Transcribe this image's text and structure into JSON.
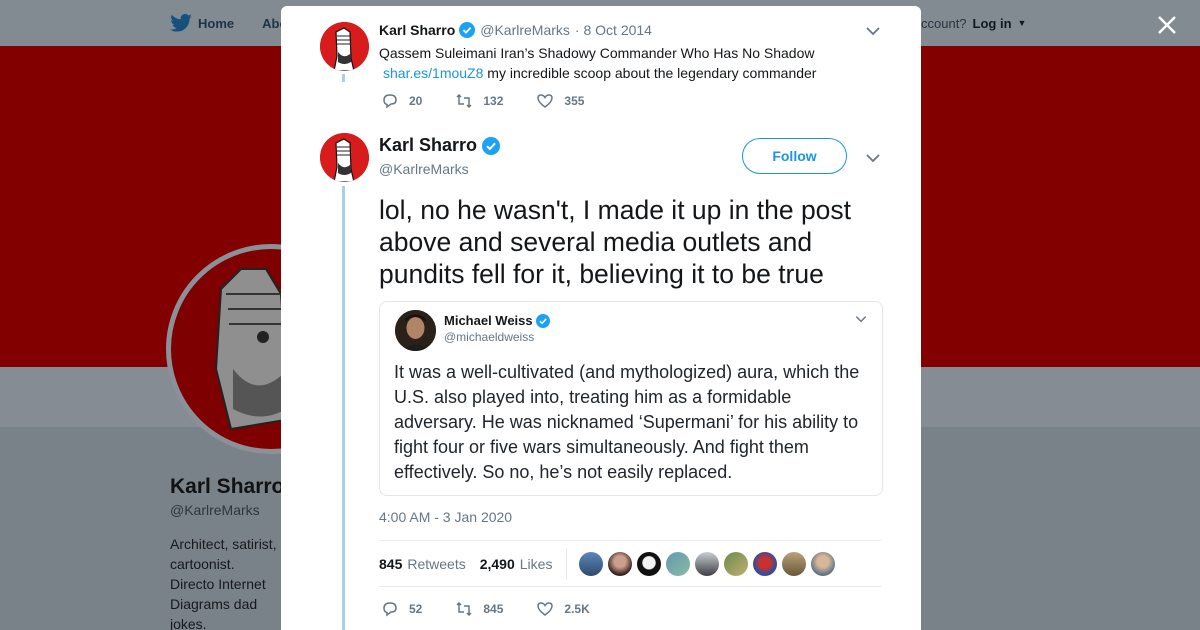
{
  "background": {
    "nav": {
      "home_label": "Home",
      "about_label": "Abo"
    },
    "account_prompt": "ccount?",
    "login_label": "Log in",
    "profile": {
      "name": "Karl Sharro",
      "handle": "@KarlreMarks",
      "bio": "Architect, satirist, cartoonist. Directo Internet Diagrams dad jokes."
    }
  },
  "tweet1": {
    "name": "Karl Sharro",
    "handle": "@KarlreMarks",
    "date": "· 8 Oct 2014",
    "text": "Qassem Suleimani Iran’s Shadowy Commander Who Has No Shadow",
    "link": "shar.es/1mouZ8",
    "text_after_link": "my incredible scoop about the legendary commander",
    "replies": "20",
    "retweets": "132",
    "likes": "355"
  },
  "tweet2": {
    "name": "Karl Sharro",
    "handle": "@KarlreMarks",
    "follow_label": "Follow",
    "text": "lol, no he wasn't, I made it up in the post above and several media outlets and pundits fell for it, believing it to be true",
    "quote": {
      "name": "Michael Weiss",
      "handle": "@michaeldweiss",
      "text": "It was a well-cultivated (and mythologized) aura, which the U.S. also played into, treating him as a formidable adversary. He was nicknamed ‘Supermani’ for his ability to fight four or five wars simultaneously. And fight them effectively. So no, he’s not easily replaced."
    },
    "timestamp": "4:00 AM - 3 Jan 2020",
    "retweet_count": "845",
    "retweet_label": "Retweets",
    "like_count": "2,490",
    "like_label": "Likes",
    "replies": "52",
    "retweets": "845",
    "likes": "2.5K"
  },
  "colors": {
    "accent": "#1b95e0",
    "header_red": "#830000",
    "thread_line": "#a6d0ec"
  },
  "icons": [
    "twitter-bird-icon",
    "close-icon",
    "verified-icon",
    "chevron-down-icon",
    "reply-icon",
    "retweet-icon",
    "like-icon"
  ]
}
